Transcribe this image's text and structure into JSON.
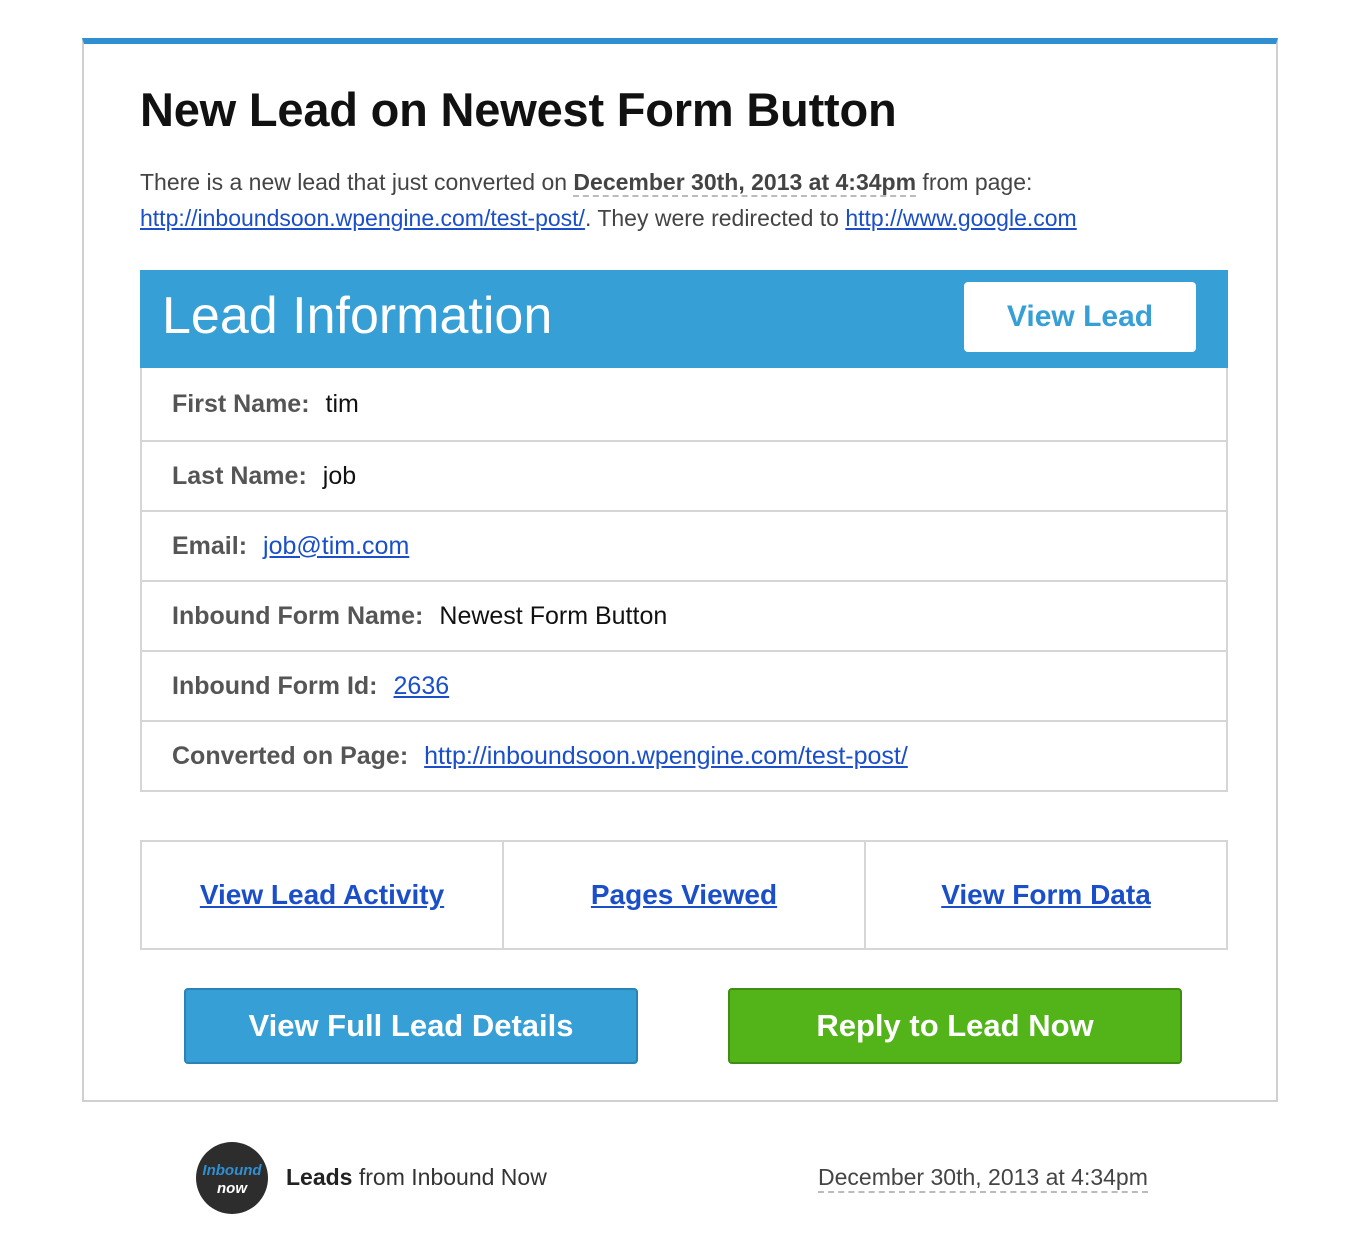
{
  "header": {
    "title": "New Lead on Newest Form Button"
  },
  "intro": {
    "part1": "There is a new lead that just converted on ",
    "date": "December 30th, 2013 at 4:34pm",
    "part2": " from page: ",
    "page_url": "http://inboundsoon.wpengine.com/test-post/",
    "part3": ". They were redirected to ",
    "redirect_url": "http://www.google.com"
  },
  "lead_info": {
    "heading": "Lead Information",
    "view_lead_label": "View Lead",
    "rows": [
      {
        "label": "First Name:",
        "value": "tim"
      },
      {
        "label": "Last Name:",
        "value": "job"
      },
      {
        "label": "Email:",
        "value": "job@tim.com"
      },
      {
        "label": "Inbound Form Name:",
        "value": "Newest Form Button"
      },
      {
        "label": "Inbound Form Id:",
        "value": "2636"
      },
      {
        "label": "Converted on Page:",
        "value": "http://inboundsoon.wpengine.com/test-post/"
      }
    ]
  },
  "actions": {
    "activity": "View Lead Activity",
    "pages": "Pages Viewed",
    "form_data": "View Form Data"
  },
  "buttons": {
    "full_details": "View Full Lead Details",
    "reply": "Reply to Lead Now"
  },
  "footer": {
    "logo_line1": "Inbound",
    "logo_line2": "now",
    "from_bold": "Leads",
    "from_rest": " from Inbound Now",
    "date": "December 30th, 2013 at 4:34pm"
  },
  "colors": {
    "accent_blue": "#369fd6",
    "top_border": "#2f8fd1",
    "reply_green": "#52b418",
    "link": "#1a4fc9"
  }
}
